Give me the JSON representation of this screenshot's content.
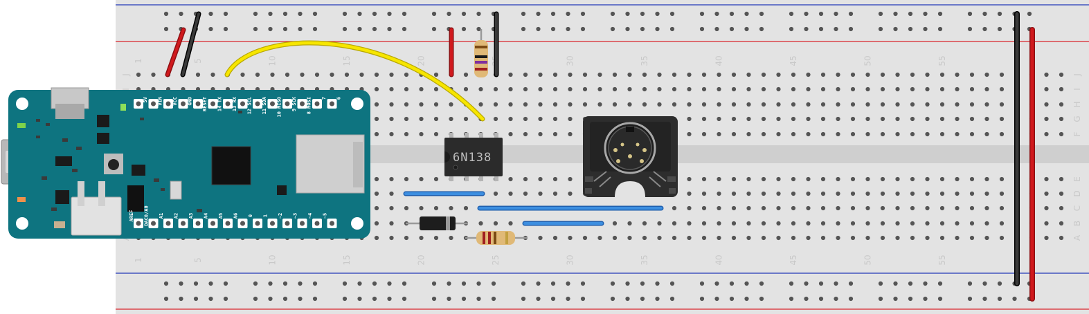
{
  "breadboard": {
    "column_numbers": [
      "1",
      "5",
      "10",
      "15",
      "20",
      "25",
      "30",
      "35",
      "40",
      "45",
      "50",
      "55"
    ],
    "row_letters_top": [
      "J",
      "I",
      "H",
      "G",
      "F"
    ],
    "row_letters_bottom": [
      "E",
      "D",
      "C",
      "B",
      "A"
    ]
  },
  "board": {
    "pins_top": [
      "5V",
      "VIN",
      "VCC",
      "GND",
      "RESET",
      "14 TX",
      "13 RX",
      "12 SCL",
      "11 SDA",
      "10 MISO",
      "9 SCK",
      "8 MOSI",
      "7",
      "6"
    ],
    "pins_bottom": [
      "AREF",
      "DAC0/A0",
      "A1",
      "A2",
      "A3",
      "A4",
      "A5",
      "A6",
      "0",
      "1",
      "~2",
      "~3",
      "~4",
      "~5"
    ]
  },
  "optocoupler": {
    "label": "6N138"
  },
  "colors": {
    "board": "#0e7480",
    "breadboard": "#e3e3e3",
    "rail_red": "#d9262b",
    "rail_blue": "#2238b8",
    "wire_yellow": "#f7e600",
    "wire_red": "#c2171a",
    "wire_black": "#222222",
    "jumper_blue": "#2e7ad1"
  }
}
